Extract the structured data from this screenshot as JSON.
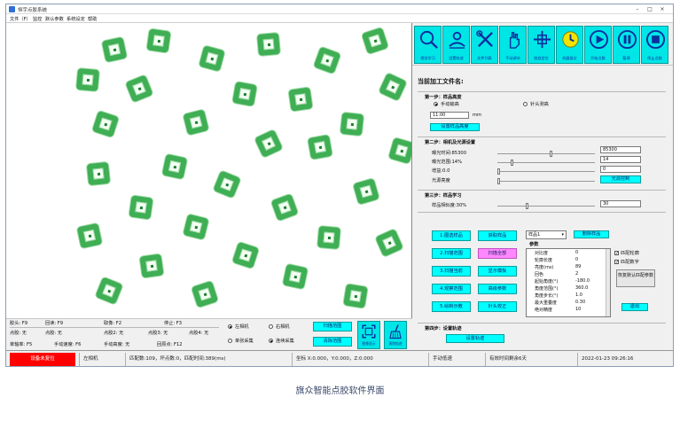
{
  "window": {
    "title": "恒宇点胶系统"
  },
  "menu": [
    "文件（F）",
    "监控",
    "默认参数",
    "系统设定",
    "帮助"
  ],
  "toolbar": [
    {
      "label": "视觉学习",
      "icon": "magnifier-icon"
    },
    {
      "label": "设置轨迹",
      "icon": "trajectory-icon"
    },
    {
      "label": "文件列表",
      "icon": "tools-icon"
    },
    {
      "label": "手动调节",
      "icon": "hand-icon"
    },
    {
      "label": "校准定位",
      "icon": "crosshair-icon"
    },
    {
      "label": "机器复位",
      "icon": "reset-icon"
    },
    {
      "label": "开始点胶",
      "icon": "play-icon"
    },
    {
      "label": "暂停",
      "icon": "pause-icon"
    },
    {
      "label": "停止点胶",
      "icon": "stop-icon"
    }
  ],
  "file_name_label": "当前加工文件名:",
  "step1": {
    "title": "第一步：样品高度",
    "manual": "手动输高",
    "probe": "针头测高",
    "height_value": "11.00",
    "height_unit": "mm",
    "set_button": "设置样品高度"
  },
  "step2": {
    "title": "第二步：相机及光源设置",
    "exposure_label": "曝光时间:85300",
    "exposure_value": "85300",
    "exposure_level": 0.55,
    "light_label": "曝光范围:14%",
    "light_value": "14",
    "light_level": 0.14,
    "gain_label": "增益:0.0",
    "gain_value": "0",
    "gain_level": 0.0,
    "source_label": "光源亮度",
    "light_control_button": "光源控制"
  },
  "step3": {
    "title": "第三步：样品学习",
    "similarity_label": "样品相似度:30%",
    "similarity_value": "30",
    "similarity_level": 0.3
  },
  "actions": {
    "b1": "1.圈选样品",
    "b2": "获取样品",
    "b3": "2.扫描范围",
    "b4": "扫描全部",
    "b5": "3.扫描当前",
    "b6": "显示模板",
    "b7": "4.观察范围",
    "b8": "高级参数",
    "b9": "5.绘制示教",
    "b10": "针头校正"
  },
  "sample_select": "样品1",
  "delete_sample": "删除样品",
  "param_header": "参数",
  "params": [
    {
      "name": "对比度",
      "value": "0"
    },
    {
      "name": "轮廓长度",
      "value": "0"
    },
    {
      "name": "亮度(ms)",
      "value": "89"
    },
    {
      "name": "回色",
      "value": "2"
    },
    {
      "name": "起始角度(°)",
      "value": "-180.0"
    },
    {
      "name": "角度范围(°)",
      "value": "360.0"
    },
    {
      "name": "角度步长(°)",
      "value": "1.0"
    },
    {
      "name": "最大重叠度",
      "value": "0.30"
    },
    {
      "name": "绝对精度",
      "value": "10"
    }
  ],
  "match_contour": "匹配轮廓",
  "match_digit": "匹配数字",
  "restore_default": "恢复默认匹配参数",
  "exit_button": "退出",
  "step4": {
    "title": "第四步：设置轨迹",
    "button": "设置轨迹"
  },
  "info_labels": {
    "r1": [
      "胶头:  F9",
      "回读:  F9",
      "取像:  F2",
      "停止:  F3"
    ],
    "r2": [
      "点胶:  无",
      "点胶:  无",
      "点胶2:  无",
      "点胶3:  无",
      "点胶4:  无"
    ],
    "r3": [
      "单轴率:  F5",
      "手动速度:  F6",
      "手动高度:  无",
      "回原点:  F12"
    ]
  },
  "camera": {
    "left": "左相机",
    "right": "右相机",
    "single": "单张采集",
    "continuous": "连续采集"
  },
  "scan_range": "扫描范围",
  "clear_range": "清除范围",
  "big_buttons": [
    "图像显示",
    "清除轨迹"
  ],
  "status": {
    "alarm": "设备未复位",
    "camera": "左相机",
    "match": "匹配数:109，坏点数:0，匹配时间:389(ms)",
    "coords": "坐标 X:0.000，Y:0.000，Z:0.000",
    "mode": "手动低速",
    "license": "有效时间剩余6天",
    "datetime": "2022-01-23 09:26:16"
  },
  "caption": "旗众智能点胶软件界面",
  "colors": {
    "accent": "#00ffff",
    "part": "#3fae54",
    "alarm": "#ff0000",
    "pink": "#ff88ff"
  }
}
